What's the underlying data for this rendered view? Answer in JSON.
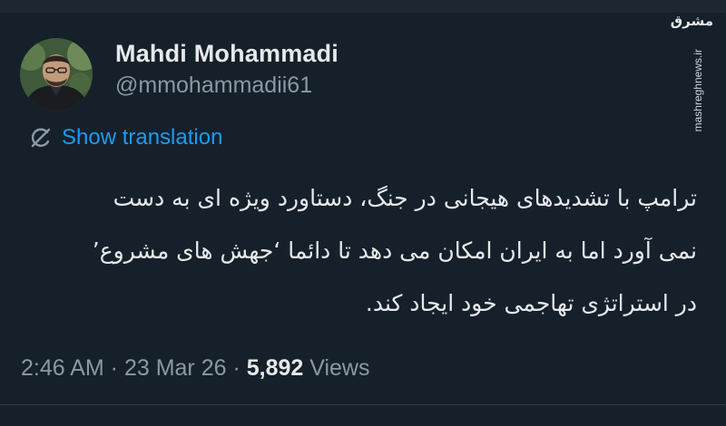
{
  "author": {
    "name": "Mahdi Mohammadi",
    "handle": "@mmohammadii61"
  },
  "translate": {
    "label": "Show translation",
    "icon": "translate-icon"
  },
  "tweet": {
    "lines": [
      "ترامپ با تشدیدهای هیجانی در جنگ، دستاورد ویژه ای به دست",
      "نمی آورد اما به ایران امکان می دهد تا دائما ‘جهش های مشروع’",
      "در استراتژی تهاجمی خود ایجاد کند."
    ]
  },
  "meta": {
    "time": "2:46 AM",
    "separator1": " · ",
    "date": "23 Mar 26",
    "separator2": " · ",
    "views_count": "5,892",
    "views_label": " Views"
  },
  "watermark": {
    "logo": "مشرق",
    "url": "mashreghnews.ir"
  },
  "colors": {
    "background": "#15202b",
    "text": "#e7e9ea",
    "secondary": "#8b98a5",
    "accent": "#1d9bf0"
  }
}
